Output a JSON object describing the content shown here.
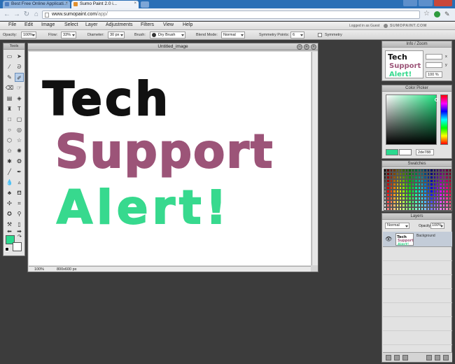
{
  "browser": {
    "tabs": [
      {
        "label": "Best Free Online Applicati...",
        "close": "×"
      },
      {
        "label": "Sumo Paint 2.0 i...",
        "close": "×"
      }
    ],
    "url_domain": "www.sumopaint.com",
    "url_path": "/app/"
  },
  "menu": {
    "items": [
      "File",
      "Edit",
      "Image",
      "Select",
      "Layer",
      "Adjustments",
      "Filters",
      "View",
      "Help"
    ],
    "guest_text": "Logged in as Guest",
    "brand": "SUMOPAINT.COM"
  },
  "options": {
    "opacity_label": "Opacity:",
    "opacity_value": "100%",
    "flow_label": "Flow:",
    "flow_value": "33%",
    "diameter_label": "Diameter:",
    "diameter_value": "30 px",
    "brush_label": "Brush:",
    "brush_value": "Dry Brush",
    "blend_label": "Blend Mode:",
    "blend_value": "Normal",
    "sympoints_label": "Symmetry Points:",
    "sympoints_value": "6",
    "symmetry_label": "Symmetry"
  },
  "tools_panel": {
    "title": "Tools",
    "foreground_color": "#2bd98f",
    "background_color": "#ffffff"
  },
  "document": {
    "title": "Untitled_image",
    "zoom": "100%",
    "size": "800x600 px",
    "drawn_text": [
      {
        "text": "Tech",
        "color": "#111111"
      },
      {
        "text": "Support",
        "color": "#9c5478"
      },
      {
        "text": "Alert!",
        "color": "#37d98e"
      }
    ]
  },
  "info_panel": {
    "title": "Info / Zoom",
    "x_label": "x",
    "y_label": "y",
    "zoom_value": "100 %"
  },
  "color_picker": {
    "title": "Color Picker",
    "hex_value": "2de788",
    "selected_color": "#2bd98f"
  },
  "swatches": {
    "title": "Swatches"
  },
  "layers": {
    "title": "Layers",
    "blend_mode": "Normal",
    "opacity_label": "Opacity:",
    "opacity_value": "100%",
    "layer_name": "Background"
  }
}
